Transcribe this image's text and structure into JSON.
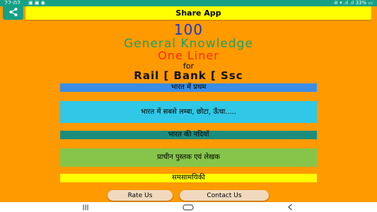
{
  "status": {
    "time": "22:02",
    "notifications": "▣ ▣ ◉",
    "right": "⊘ ▾ .ıl .ıl 33% ▭"
  },
  "top": {
    "share_label": "Share App"
  },
  "header": {
    "count": "100",
    "subject": "General Knowledge",
    "type": "One Liner",
    "for": "for",
    "exams": "Rail [ Bank [ Ssc"
  },
  "menu": [
    {
      "label": "भारत में प्रथम",
      "color": "#3a8ee8"
    },
    {
      "label": "भारत में सबसे लम्बा, छोटा, ऊँचा.....",
      "color": "#30c8e6"
    },
    {
      "label": "भारत की नदियाँ",
      "color": "#1b8d7e"
    },
    {
      "label": "प्राचीन पुस्तक एवं लेखक",
      "color": "#86c54a"
    },
    {
      "label": "समसामयिकी",
      "color": "#ffff00"
    }
  ],
  "actions": {
    "rate": "Rate Us",
    "contact": "Contact Us"
  },
  "colors": {
    "background": "#ff9a00",
    "accent": "#16a085",
    "bar": "#ffff00"
  },
  "icons": {
    "share": "share-icon",
    "nav": [
      "recents-icon",
      "home-icon",
      "back-icon"
    ]
  }
}
